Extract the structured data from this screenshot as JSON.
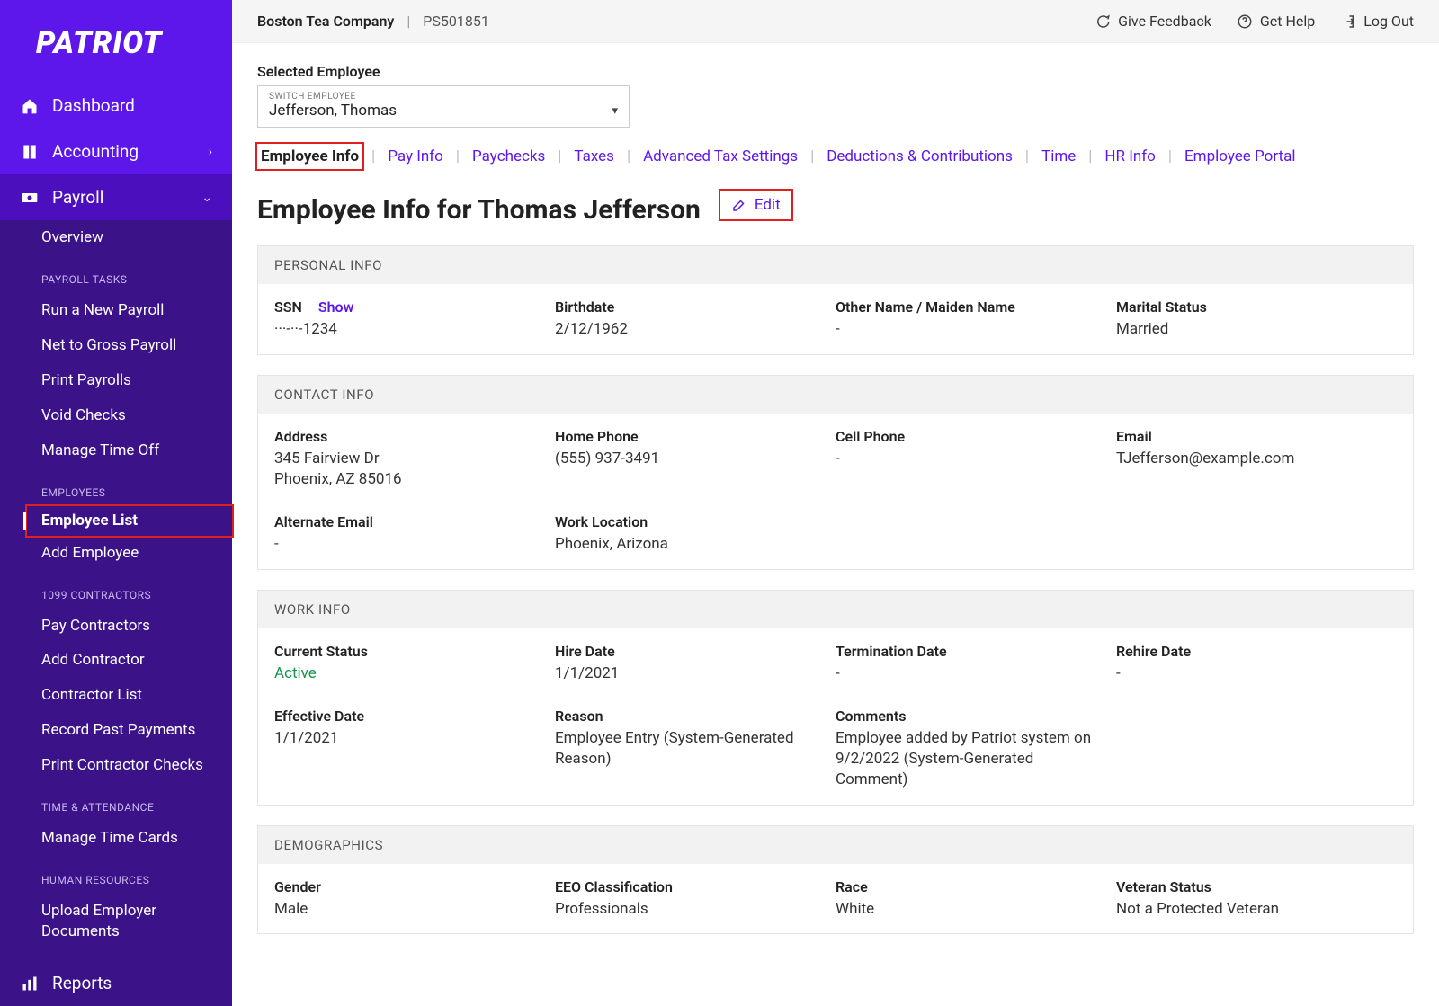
{
  "brand": "PATRIOT",
  "nav": {
    "dashboard": "Dashboard",
    "accounting": "Accounting",
    "payroll": "Payroll",
    "reports": "Reports"
  },
  "payroll_sub": {
    "overview": "Overview",
    "tasks_head": "PAYROLL TASKS",
    "run": "Run a New Payroll",
    "net": "Net to Gross Payroll",
    "print": "Print Payrolls",
    "void": "Void Checks",
    "timeoff": "Manage Time Off",
    "emp_head": "EMPLOYEES",
    "emp_list": "Employee List",
    "emp_add": "Add Employee",
    "contractors_head": "1099 CONTRACTORS",
    "pay_contractors": "Pay Contractors",
    "add_contractor": "Add Contractor",
    "contractor_list": "Contractor List",
    "record_past": "Record Past Payments",
    "print_contractor": "Print Contractor Checks",
    "ta_head": "TIME & ATTENDANCE",
    "manage_tc": "Manage Time Cards",
    "hr_head": "HUMAN RESOURCES",
    "upload_docs": "Upload Employer Documents"
  },
  "topbar": {
    "company": "Boston Tea Company",
    "code": "PS501851",
    "feedback": "Give Feedback",
    "help": "Get Help",
    "logout": "Log Out"
  },
  "selected": {
    "label": "Selected Employee",
    "switch": "SWITCH EMPLOYEE",
    "value": "Jefferson, Thomas"
  },
  "tabs": {
    "info": "Employee Info",
    "pay": "Pay Info",
    "paychecks": "Paychecks",
    "taxes": "Taxes",
    "advanced": "Advanced Tax Settings",
    "deductions": "Deductions & Contributions",
    "time": "Time",
    "hr": "HR Info",
    "portal": "Employee Portal"
  },
  "page": {
    "title": "Employee Info for Thomas Jefferson",
    "edit": "Edit"
  },
  "personal": {
    "heading": "PERSONAL INFO",
    "ssn_label": "SSN",
    "ssn_show": "Show",
    "ssn_value": "···-··-1234",
    "birth_label": "Birthdate",
    "birth_value": "2/12/1962",
    "other_label": "Other Name / Maiden Name",
    "other_value": "-",
    "marital_label": "Marital Status",
    "marital_value": "Married"
  },
  "contact": {
    "heading": "CONTACT INFO",
    "address_label": "Address",
    "address_value": "345 Fairview Dr\nPhoenix, AZ 85016",
    "home_label": "Home Phone",
    "home_value": "(555) 937-3491",
    "cell_label": "Cell Phone",
    "cell_value": "-",
    "email_label": "Email",
    "email_value": "TJefferson@example.com",
    "alt_label": "Alternate Email",
    "alt_value": "-",
    "workloc_label": "Work Location",
    "workloc_value": "Phoenix, Arizona"
  },
  "work": {
    "heading": "WORK INFO",
    "status_label": "Current Status",
    "status_value": "Active",
    "hire_label": "Hire Date",
    "hire_value": "1/1/2021",
    "term_label": "Termination Date",
    "term_value": "-",
    "rehire_label": "Rehire Date",
    "rehire_value": "-",
    "eff_label": "Effective Date",
    "eff_value": "1/1/2021",
    "reason_label": "Reason",
    "reason_value": "Employee Entry (System-Generated Reason)",
    "comments_label": "Comments",
    "comments_value": "Employee added by Patriot system on 9/2/2022 (System-Generated Comment)"
  },
  "demo": {
    "heading": "DEMOGRAPHICS",
    "gender_label": "Gender",
    "gender_value": "Male",
    "eeo_label": "EEO Classification",
    "eeo_value": "Professionals",
    "race_label": "Race",
    "race_value": "White",
    "vet_label": "Veteran Status",
    "vet_value": "Not a Protected Veteran"
  }
}
